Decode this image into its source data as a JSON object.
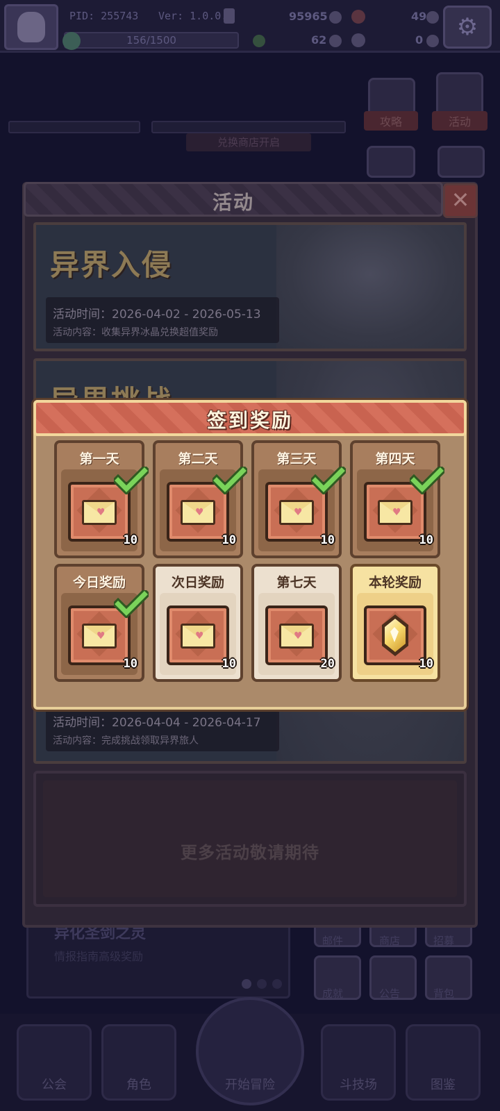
{
  "header": {
    "pid": "PID: 255743",
    "version": "Ver: 1.0.0.0",
    "exp": "156/1500",
    "coins": "95965",
    "gems": "49",
    "clovers": "62",
    "tickets": "0"
  },
  "side_buttons": {
    "guide": "攻略",
    "activity": "活动"
  },
  "shop_notice": "兑换商店开启",
  "activity_modal": {
    "title": "活动",
    "banners": [
      {
        "title": "异界入侵",
        "time": "活动时间：2026-04-02 - 2026-05-13",
        "desc": "活动内容：收集异界冰晶兑换超值奖励"
      },
      {
        "title": "异界挑战",
        "time": "活动时间：2026-04-04 - 2026-04-17",
        "desc": "活动内容：完成挑战领取异界旅人"
      }
    ],
    "more": "更多活动敬请期待"
  },
  "sign_in": {
    "title": "签到奖励",
    "days": [
      {
        "label": "第一天",
        "qty": "10",
        "claimed": true,
        "item": "envelope-icon"
      },
      {
        "label": "第二天",
        "qty": "10",
        "claimed": true,
        "item": "envelope-icon"
      },
      {
        "label": "第三天",
        "qty": "10",
        "claimed": true,
        "item": "envelope-icon"
      },
      {
        "label": "第四天",
        "qty": "10",
        "claimed": true,
        "item": "envelope-icon"
      },
      {
        "label": "今日奖励",
        "qty": "10",
        "claimed": true,
        "item": "envelope-icon"
      },
      {
        "label": "次日奖励",
        "qty": "10",
        "claimed": false,
        "item": "envelope-icon"
      },
      {
        "label": "第七天",
        "qty": "20",
        "claimed": false,
        "item": "envelope-icon"
      },
      {
        "label": "本轮奖励",
        "qty": "10",
        "claimed": false,
        "item": "gem-icon"
      }
    ],
    "colors": {
      "claimed_card": "#a87e5e",
      "pending_card": "#ece0cf",
      "final_card": "#f6e2a2",
      "check": "#7ad35a"
    }
  },
  "background_panel": {
    "title": "异化圣剑之灵",
    "subtitle": "情报指南高级奖励",
    "right_buttons": [
      "邮件",
      "商店",
      "招募",
      "成就",
      "公告",
      "背包"
    ]
  },
  "bottom_nav": {
    "items": [
      "公会",
      "角色",
      "开始冒险",
      "斗技场",
      "图鉴"
    ]
  }
}
